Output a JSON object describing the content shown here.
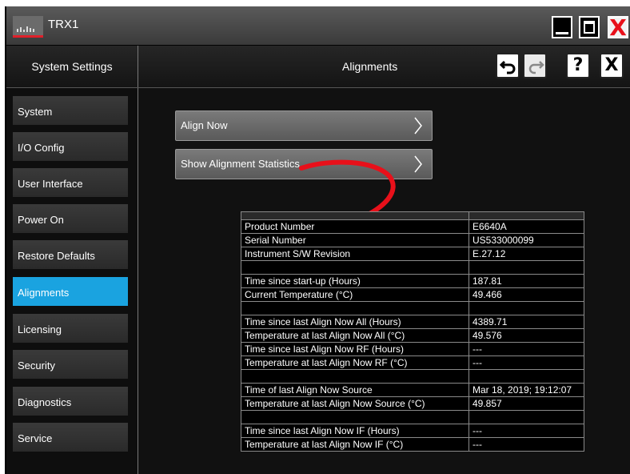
{
  "window": {
    "title": "TRX1",
    "controls": {
      "minimize_icon": "minimize-icon",
      "maximize_icon": "maximize-icon",
      "close_glyph": "X"
    }
  },
  "header": {
    "section_title": "System Settings",
    "page_title": "Alignments",
    "help_label": "?",
    "close_label": "X"
  },
  "sidebar": {
    "items": [
      {
        "label": "System",
        "active": false
      },
      {
        "label": "I/O Config",
        "active": false
      },
      {
        "label": "User Interface",
        "active": false
      },
      {
        "label": "Power On",
        "active": false
      },
      {
        "label": "Restore Defaults",
        "active": false
      },
      {
        "label": "Alignments",
        "active": true
      },
      {
        "label": "Licensing",
        "active": false
      },
      {
        "label": "Security",
        "active": false
      },
      {
        "label": "Diagnostics",
        "active": false
      },
      {
        "label": "Service",
        "active": false
      }
    ]
  },
  "main": {
    "buttons": [
      {
        "label": "Align Now"
      },
      {
        "label": "Show Alignment Statistics"
      }
    ],
    "stats_rows": [
      [
        "Product Number",
        "E6640A"
      ],
      [
        "Serial Number",
        "US533000099"
      ],
      [
        "Instrument S/W Revision",
        "E.27.12"
      ],
      [
        "",
        ""
      ],
      [
        "Time since start-up (Hours)",
        "187.81"
      ],
      [
        "Current Temperature (°C)",
        "49.466"
      ],
      [
        "",
        ""
      ],
      [
        "Time since last Align Now All (Hours)",
        "4389.71"
      ],
      [
        "Temperature at last Align Now All (°C)",
        "49.576"
      ],
      [
        "Time since last Align Now RF (Hours)",
        "---"
      ],
      [
        "Temperature at last Align Now RF (°C)",
        "---"
      ],
      [
        "",
        ""
      ],
      [
        "Time of last Align Now Source",
        "Mar 18, 2019; 19:12:07"
      ],
      [
        "Temperature at last Align Now Source (°C)",
        "49.857"
      ],
      [
        "",
        ""
      ],
      [
        "Time since last Align Now IF (Hours)",
        "---"
      ],
      [
        "Temperature at last Align Now IF (°C)",
        "---"
      ]
    ]
  },
  "colors": {
    "accent": "#1aa3e0",
    "annotation_arrow": "#e8101a",
    "close_red": "#e8101a"
  }
}
